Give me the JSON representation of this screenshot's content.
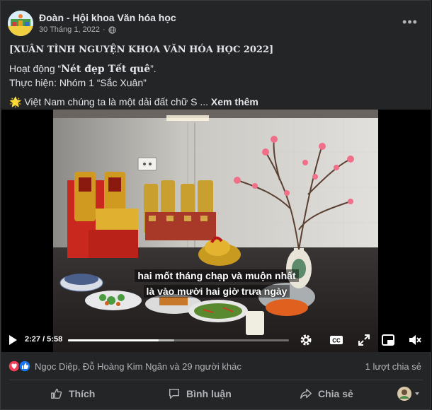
{
  "post": {
    "author": "Đoàn - Hội khoa Văn hóa học",
    "date": "30 Tháng 1, 2022",
    "audience_icon": "globe-icon",
    "more_icon": "more-icon",
    "more_label": "•••"
  },
  "text": {
    "title": "[XUÂN TÌNH NGUYỆN KHOA VĂN HÓA HỌC 2022]",
    "activity_prefix": "Hoạt động “",
    "activity_name": "Nét đẹp Tết quê",
    "activity_suffix": "”.",
    "team": "Thực hiện: Nhóm 1 “Sắc Xuân”",
    "excerpt_emoji": "🌟",
    "excerpt": " Việt Nam chúng ta là một dải đất chữ S ... ",
    "see_more": "Xem thêm"
  },
  "video": {
    "subtitle_line1": "hai mốt tháng chạp và muộn nhất",
    "subtitle_line2": "là vào mười hai giờ trưa ngày",
    "time": "2:27 / 5:58",
    "progress_fraction": 0.41,
    "buffered_fraction": 0.48
  },
  "stats": {
    "reactions": [
      "love",
      "like"
    ],
    "reacted_by": "Ngọc Diệp, Đỗ Hoàng Kim Ngân và 29 người khác",
    "shares": "1 lượt chia sẻ"
  },
  "actions": {
    "like": "Thích",
    "comment": "Bình luận",
    "share": "Chia sẻ"
  },
  "colors": {
    "background": "#242526",
    "text": "#e4e6eb",
    "muted": "#b0b3b8",
    "love": "#f33e58",
    "like": "#1877f2"
  }
}
